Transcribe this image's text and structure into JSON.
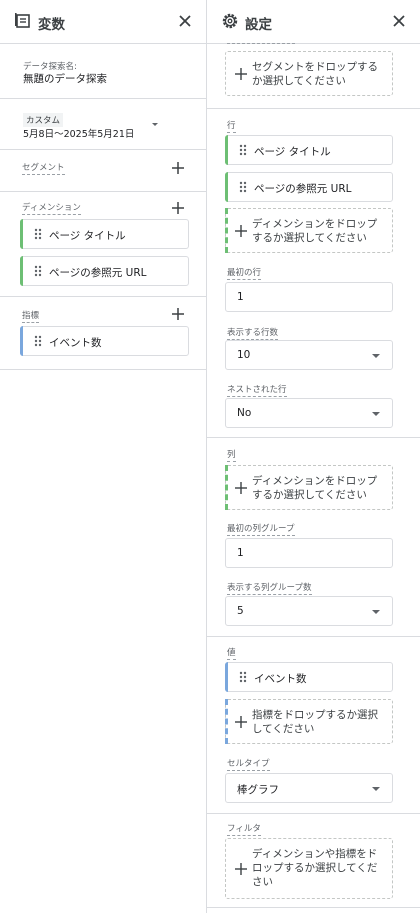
{
  "variables": {
    "title": "変数",
    "exploration_name_label": "データ探索名:",
    "exploration_name": "無題のデータ探索",
    "date_badge": "カスタム",
    "date_range": "5月8日～2025年5月21日",
    "segments_label": "セグメント",
    "dimensions_label": "ディメンション",
    "dimensions": [
      "ページ タイトル",
      "ページの参照元 URL"
    ],
    "metrics_label": "指標",
    "metrics": [
      "イベント数"
    ]
  },
  "settings": {
    "title": "設定",
    "segment_drop": "セグメントをドロップするか選択してください",
    "rows_label": "行",
    "rows": [
      "ページ タイトル",
      "ページの参照元 URL"
    ],
    "rows_drop": "ディメンションをドロップするか選択してください",
    "first_row_label": "最初の行",
    "first_row_value": "1",
    "show_rows_label": "表示する行数",
    "show_rows_value": "10",
    "nested_rows_label": "ネストされた行",
    "nested_rows_value": "No",
    "columns_label": "列",
    "columns_drop": "ディメンションをドロップするか選択してください",
    "first_col_group_label": "最初の列グループ",
    "first_col_group_value": "1",
    "show_col_groups_label": "表示する列グループ数",
    "show_col_groups_value": "5",
    "values_label": "値",
    "values": [
      "イベント数"
    ],
    "values_drop": "指標をドロップするか選択してください",
    "cell_type_label": "セルタイプ",
    "cell_type_value": "棒グラフ",
    "filters_label": "フィルタ",
    "filters_drop": "ディメンションや指標をドロップするか選択してください"
  },
  "colors": {
    "dimension": "#6dbf74",
    "metric": "#7aa7dd"
  }
}
